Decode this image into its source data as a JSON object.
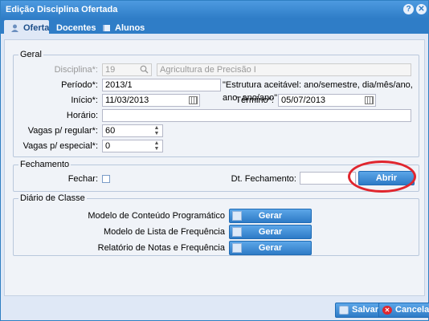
{
  "window": {
    "title": "Edição Disciplina Ofertada",
    "help_icon": "question-icon",
    "close_icon": "close-icon"
  },
  "tabs": [
    {
      "label": "Oferta",
      "icon": "user-icon",
      "active": true
    },
    {
      "label": "Docentes",
      "icon": "",
      "active": false
    },
    {
      "label": "Alunos",
      "icon": "book-icon",
      "active": false
    }
  ],
  "geral": {
    "legend": "Geral",
    "disciplina_label": "Disciplina*:",
    "disciplina_code": "19",
    "disciplina_name": "Agricultura de Precisão I",
    "periodo_label": "Período*:",
    "periodo_value": "2013/1",
    "periodo_hint": "\"Estrutura aceitável: ano/semestre, dia/mês/ano, ano, ano/ano\"",
    "inicio_label": "Início*:",
    "inicio_value": "11/03/2013",
    "termino_label": "Término*:",
    "termino_value": "05/07/2013",
    "horario_label": "Horário:",
    "horario_value": "",
    "vagas_regular_label": "Vagas p/ regular*:",
    "vagas_regular_value": "60",
    "vagas_especial_label": "Vagas p/ especial*:",
    "vagas_especial_value": "0"
  },
  "fechamento": {
    "legend": "Fechamento",
    "fechar_label": "Fechar:",
    "fechar_checked": false,
    "dt_label": "Dt. Fechamento:",
    "dt_value": "",
    "abrir_label": "Abrir"
  },
  "diario": {
    "legend": "Diário de Classe",
    "rows": [
      {
        "label": "Modelo de Conteúdo Programático",
        "button": "Gerar"
      },
      {
        "label": "Modelo de Lista de Frequência",
        "button": "Gerar"
      },
      {
        "label": "Relatório de Notas e Frequência",
        "button": "Gerar"
      }
    ]
  },
  "footer": {
    "save_label": "Salvar",
    "cancel_label": "Cancelar"
  },
  "colors": {
    "accent": "#2f7dc7",
    "annotation": "#e0262e"
  }
}
